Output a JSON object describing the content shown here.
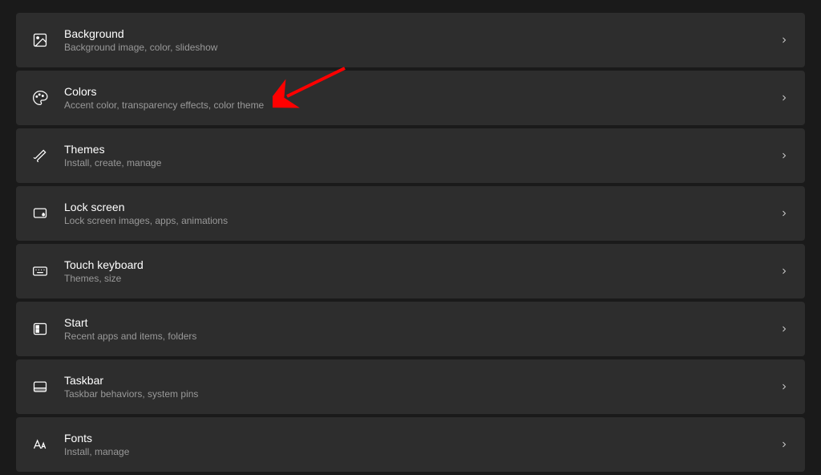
{
  "settings": {
    "items": [
      {
        "title": "Background",
        "subtitle": "Background image, color, slideshow",
        "icon": "image-icon"
      },
      {
        "title": "Colors",
        "subtitle": "Accent color, transparency effects, color theme",
        "icon": "palette-icon"
      },
      {
        "title": "Themes",
        "subtitle": "Install, create, manage",
        "icon": "brush-icon"
      },
      {
        "title": "Lock screen",
        "subtitle": "Lock screen images, apps, animations",
        "icon": "lock-screen-icon"
      },
      {
        "title": "Touch keyboard",
        "subtitle": "Themes, size",
        "icon": "keyboard-icon"
      },
      {
        "title": "Start",
        "subtitle": "Recent apps and items, folders",
        "icon": "start-icon"
      },
      {
        "title": "Taskbar",
        "subtitle": "Taskbar behaviors, system pins",
        "icon": "taskbar-icon"
      },
      {
        "title": "Fonts",
        "subtitle": "Install, manage",
        "icon": "fonts-icon"
      }
    ]
  },
  "annotation": {
    "arrow_color": "#ff0000",
    "target": "Colors"
  }
}
